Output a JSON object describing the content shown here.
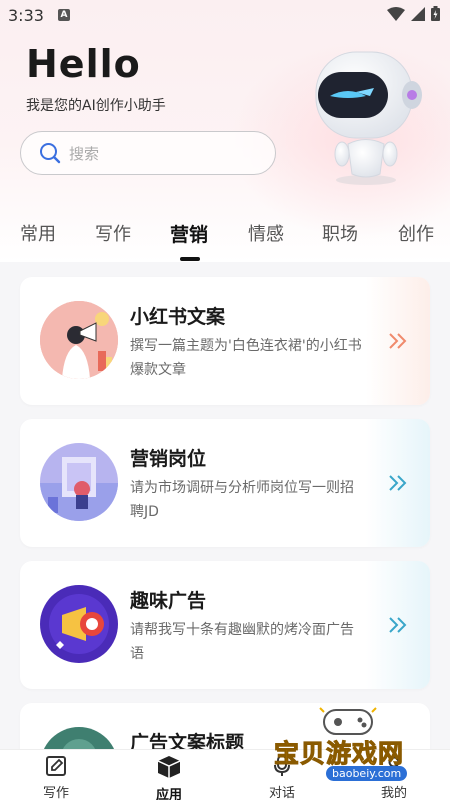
{
  "status_bar": {
    "time": "3:33",
    "notification_icon": "A"
  },
  "header": {
    "greeting": "Hello",
    "subtitle": "我是您的AI创作小助手"
  },
  "search": {
    "placeholder": "搜索"
  },
  "tabs": [
    {
      "label": "常用",
      "active": false
    },
    {
      "label": "写作",
      "active": false
    },
    {
      "label": "营销",
      "active": true
    },
    {
      "label": "情感",
      "active": false
    },
    {
      "label": "职场",
      "active": false
    },
    {
      "label": "创作",
      "active": false
    }
  ],
  "cards": [
    {
      "title": "小红书文案",
      "description": "撰写一篇主题为'白色连衣裙'的小红书爆款文章",
      "accent": "#f08a6c"
    },
    {
      "title": "营销岗位",
      "description": "请为市场调研与分析师岗位写一则招聘JD",
      "accent": "#3aa6c9"
    },
    {
      "title": "趣味广告",
      "description": "请帮我写十条有趣幽默的烤冷面广告语",
      "accent": "#3aa6c9"
    },
    {
      "title": "广告文案标题",
      "description": ""
    }
  ],
  "bottom_nav": [
    {
      "label": "写作",
      "icon": "pencil-icon"
    },
    {
      "label": "应用",
      "icon": "box-icon",
      "active": true
    },
    {
      "label": "对话",
      "icon": "microphone-icon"
    },
    {
      "label": "我的",
      "icon": "user-icon"
    }
  ],
  "watermark": {
    "brand": "宝贝游戏网",
    "url": "baobeiy.com"
  },
  "colors": {
    "background": "#f6f6f8",
    "accent_orange": "#f08a6c",
    "accent_blue": "#3aa6c9",
    "text_primary": "#1a1a1a"
  }
}
